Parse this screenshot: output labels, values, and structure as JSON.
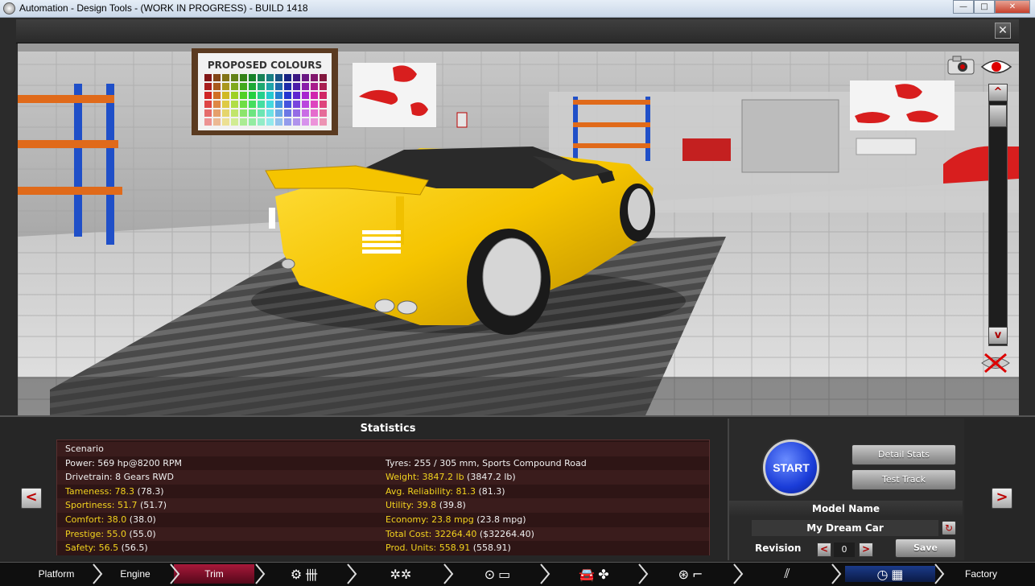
{
  "window": {
    "title": "Automation - Design Tools - (WORK IN PROGRESS) - BUILD 1418",
    "controls": {
      "minimize": "—",
      "maximize": "□",
      "close": "✕"
    }
  },
  "viewer": {
    "close_label": "✕",
    "poster_text": "PROPOSED COLOURS",
    "scroll_up": "^",
    "scroll_down": "v",
    "car_color": "#f5c400"
  },
  "nav": {
    "prev": "<",
    "next": ">"
  },
  "statistics": {
    "title": "Statistics",
    "left": [
      {
        "label": "Scenario",
        "value": "",
        "extra": "",
        "highlight": false
      },
      {
        "label": "Power: ",
        "value": "569 hp@8200 RPM",
        "extra": "",
        "highlight": false
      },
      {
        "label": "Drivetrain: ",
        "value": "8 Gears RWD",
        "extra": "",
        "highlight": false
      },
      {
        "label": "Tameness: ",
        "value": "78.3",
        "extra": " (78.3)",
        "highlight": true
      },
      {
        "label": "Sportiness: ",
        "value": "51.7",
        "extra": " (51.7)",
        "highlight": true
      },
      {
        "label": "Comfort: ",
        "value": "38.0",
        "extra": " (38.0)",
        "highlight": true
      },
      {
        "label": "Prestige: ",
        "value": "55.0",
        "extra": " (55.0)",
        "highlight": true
      },
      {
        "label": "Safety: ",
        "value": "56.5",
        "extra": " (56.5)",
        "highlight": true
      }
    ],
    "right": [
      {
        "label": "",
        "value": "",
        "extra": "",
        "highlight": false
      },
      {
        "label": "Tyres: ",
        "value": "255 / 305 mm, Sports Compound Road",
        "extra": "",
        "highlight": false
      },
      {
        "label": "Weight: ",
        "value": "3847.2 lb",
        "extra": " (3847.2 lb)",
        "highlight": true
      },
      {
        "label": "Avg. Reliability: ",
        "value": "81.3",
        "extra": " (81.3)",
        "highlight": true
      },
      {
        "label": "Utility: ",
        "value": "39.8",
        "extra": " (39.8)",
        "highlight": true
      },
      {
        "label": "Economy: ",
        "value": "23.8 mpg",
        "extra": " (23.8 mpg)",
        "highlight": true
      },
      {
        "label": "Total Cost: ",
        "value": "32264.40",
        "extra": " ($32264.40)",
        "highlight": true
      },
      {
        "label": "Prod. Units: ",
        "value": "558.91",
        "extra": " (558.91)",
        "highlight": true
      }
    ]
  },
  "actions": {
    "start": "START",
    "detail_stats": "Detail Stats",
    "test_track": "Test Track",
    "model_name_header": "Model Name",
    "model_name": "My Dream Car",
    "revision_label": "Revision",
    "revision_value": "0",
    "rev_prev": "<",
    "rev_next": ">",
    "save": "Save"
  },
  "tabs": [
    {
      "label": "Platform",
      "state": "normal"
    },
    {
      "label": "Engine",
      "state": "normal"
    },
    {
      "label": "Trim",
      "state": "active"
    },
    {
      "label": "Factory",
      "state": "normal"
    }
  ],
  "icon_tabs": [
    {
      "icons": "engine-gearbox-icons"
    },
    {
      "icons": "wheels-icon"
    },
    {
      "icons": "brakes-suspension-icon"
    },
    {
      "icons": "body-aero-icon"
    },
    {
      "icons": "interior-safety-icon"
    },
    {
      "icons": "fuel-exhaust-icon"
    },
    {
      "icons": "test-flag-icon"
    }
  ]
}
